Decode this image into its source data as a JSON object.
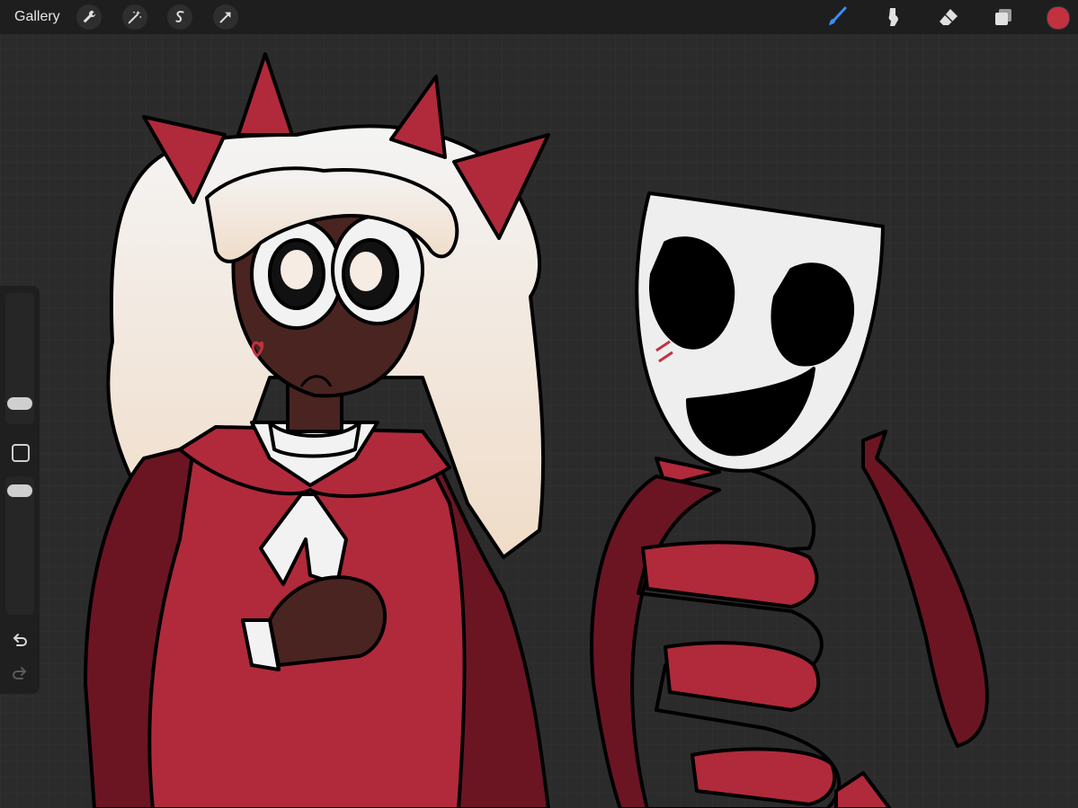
{
  "topbar": {
    "gallery_label": "Gallery",
    "left_tools": [
      "wrench-icon",
      "magic-wand-icon",
      "selection-icon",
      "transform-arrow-icon"
    ],
    "right_tools": [
      "brush-icon",
      "smudge-icon",
      "eraser-icon",
      "layers-icon"
    ],
    "active_tool": "brush-icon"
  },
  "colors": {
    "active_color": "#c2313f",
    "accent_blue": "#3c8cff",
    "background": "#2b2b2b"
  },
  "sidebar": {
    "brush_size_level": 0.3,
    "opacity_level": 0.95,
    "icons": [
      "modify-icon",
      "undo-icon",
      "redo-icon"
    ]
  }
}
